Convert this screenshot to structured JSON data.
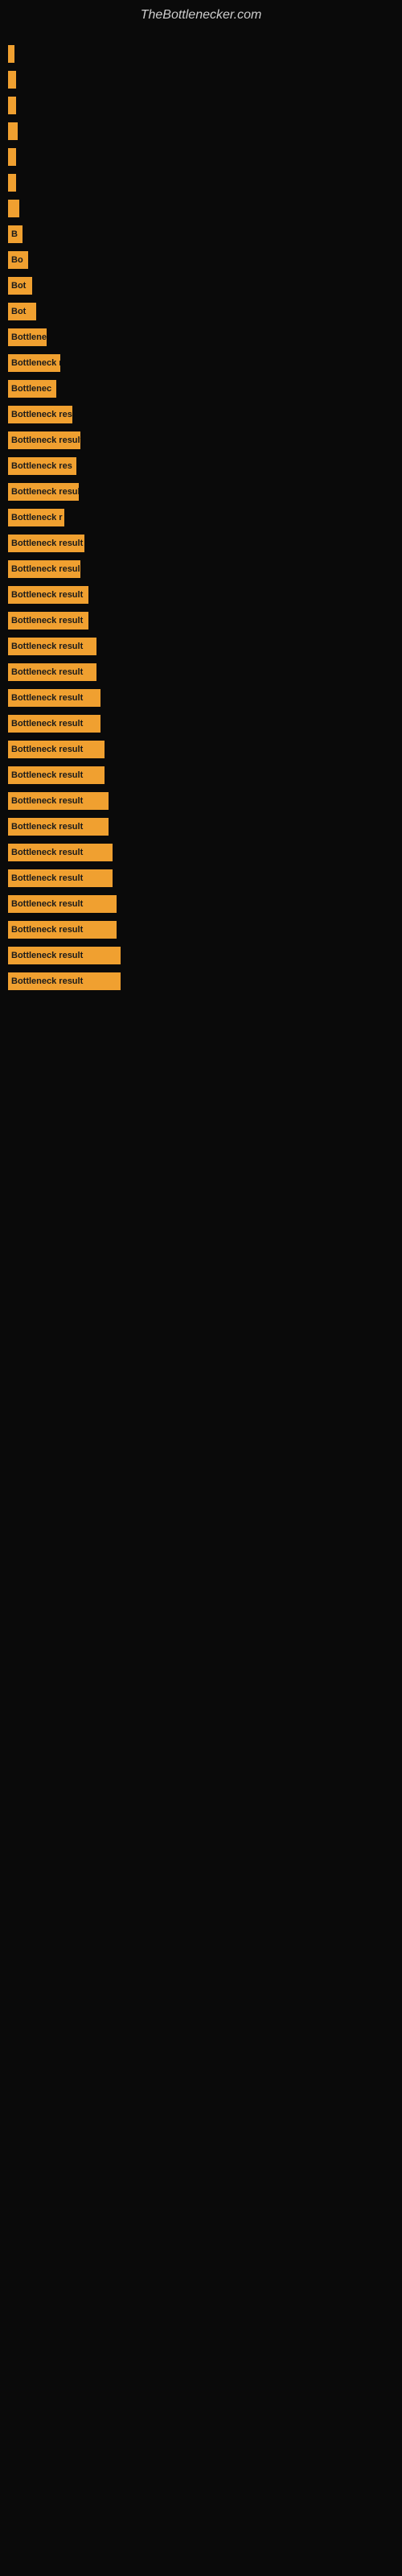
{
  "site": {
    "title": "TheBottlenecker.com"
  },
  "bars": [
    {
      "id": 1,
      "width": 8,
      "label": ""
    },
    {
      "id": 2,
      "width": 10,
      "label": ""
    },
    {
      "id": 3,
      "width": 10,
      "label": ""
    },
    {
      "id": 4,
      "width": 12,
      "label": ""
    },
    {
      "id": 5,
      "width": 10,
      "label": ""
    },
    {
      "id": 6,
      "width": 10,
      "label": ""
    },
    {
      "id": 7,
      "width": 14,
      "label": ""
    },
    {
      "id": 8,
      "width": 18,
      "label": "B"
    },
    {
      "id": 9,
      "width": 25,
      "label": "Bo"
    },
    {
      "id": 10,
      "width": 30,
      "label": "Bot"
    },
    {
      "id": 11,
      "width": 35,
      "label": "Bot"
    },
    {
      "id": 12,
      "width": 48,
      "label": "Bottlene"
    },
    {
      "id": 13,
      "width": 65,
      "label": "Bottleneck re"
    },
    {
      "id": 14,
      "width": 60,
      "label": "Bottlenec"
    },
    {
      "id": 15,
      "width": 80,
      "label": "Bottleneck res"
    },
    {
      "id": 16,
      "width": 90,
      "label": "Bottleneck result"
    },
    {
      "id": 17,
      "width": 85,
      "label": "Bottleneck res"
    },
    {
      "id": 18,
      "width": 88,
      "label": "Bottleneck resul"
    },
    {
      "id": 19,
      "width": 70,
      "label": "Bottleneck r"
    },
    {
      "id": 20,
      "width": 95,
      "label": "Bottleneck result"
    },
    {
      "id": 21,
      "width": 90,
      "label": "Bottleneck resul"
    },
    {
      "id": 22,
      "width": 100,
      "label": "Bottleneck result"
    },
    {
      "id": 23,
      "width": 100,
      "label": "Bottleneck result"
    },
    {
      "id": 24,
      "width": 110,
      "label": "Bottleneck result"
    },
    {
      "id": 25,
      "width": 110,
      "label": "Bottleneck result"
    },
    {
      "id": 26,
      "width": 115,
      "label": "Bottleneck result"
    },
    {
      "id": 27,
      "width": 115,
      "label": "Bottleneck result"
    },
    {
      "id": 28,
      "width": 120,
      "label": "Bottleneck result"
    },
    {
      "id": 29,
      "width": 120,
      "label": "Bottleneck result"
    },
    {
      "id": 30,
      "width": 125,
      "label": "Bottleneck result"
    },
    {
      "id": 31,
      "width": 125,
      "label": "Bottleneck result"
    },
    {
      "id": 32,
      "width": 130,
      "label": "Bottleneck result"
    },
    {
      "id": 33,
      "width": 130,
      "label": "Bottleneck result"
    },
    {
      "id": 34,
      "width": 135,
      "label": "Bottleneck result"
    },
    {
      "id": 35,
      "width": 135,
      "label": "Bottleneck result"
    },
    {
      "id": 36,
      "width": 140,
      "label": "Bottleneck result"
    },
    {
      "id": 37,
      "width": 140,
      "label": "Bottleneck result"
    }
  ]
}
